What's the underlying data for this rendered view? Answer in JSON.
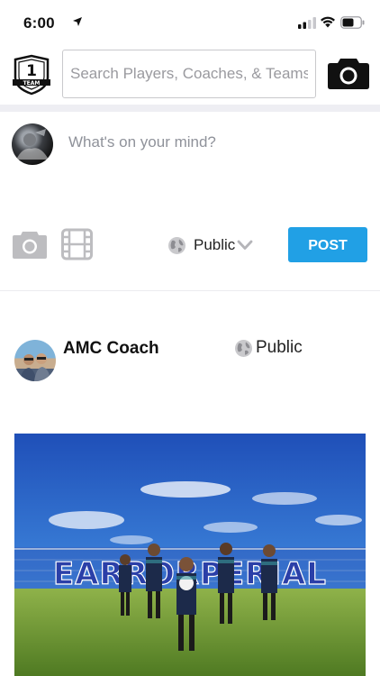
{
  "status_bar": {
    "time": "6:00",
    "icons": [
      "location-arrow-icon",
      "cellular-signal-icon",
      "wifi-icon",
      "battery-icon"
    ]
  },
  "header": {
    "logo_text": "1",
    "logo_subtext": "TEAM",
    "search_placeholder": "Search Players, Coaches, & Teams",
    "camera_icon": "camera-icon"
  },
  "composer": {
    "placeholder": "What's on your mind?",
    "photo_icon": "camera-icon",
    "video_icon": "film-icon",
    "privacy": "Public",
    "post_label": "POST"
  },
  "feed": {
    "posts": [
      {
        "author": "AMC Coach",
        "privacy": "Public",
        "photo_text": "EARRORPERIAL"
      }
    ]
  },
  "colors": {
    "accent": "#21a0e5",
    "divider": "#eeeef3",
    "placeholder": "#8f929a"
  }
}
